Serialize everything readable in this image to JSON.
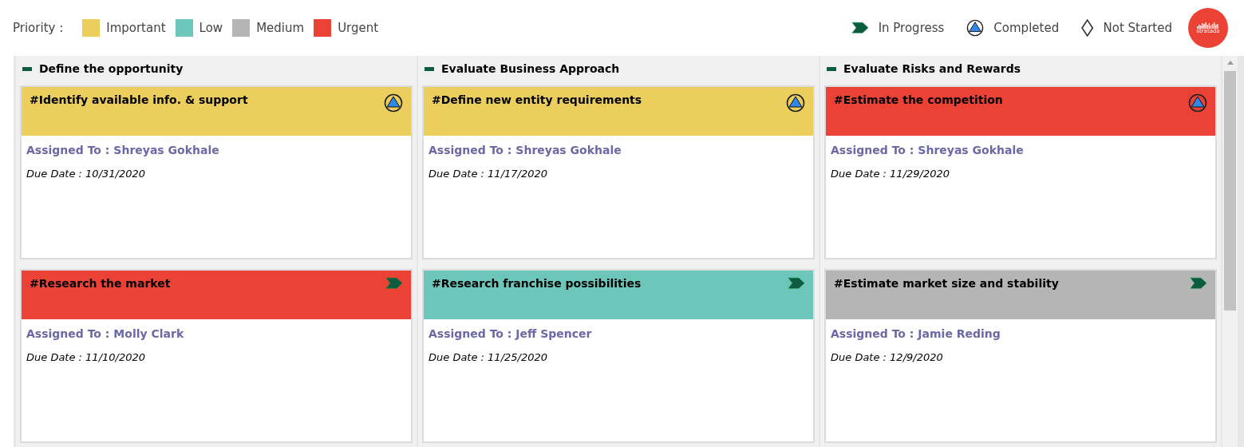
{
  "priority_legend": {
    "label": "Priority :",
    "items": [
      {
        "label": "Important",
        "color": "#ecce5c"
      },
      {
        "label": "Low",
        "color": "#6cc6b9"
      },
      {
        "label": "Medium",
        "color": "#b5b5b5"
      },
      {
        "label": "Urgent",
        "color": "#ec4236"
      }
    ]
  },
  "status_legend": [
    {
      "kind": "in_progress",
      "label": "In Progress"
    },
    {
      "kind": "completed",
      "label": "Completed"
    },
    {
      "kind": "not_started",
      "label": "Not Started"
    }
  ],
  "logo": {
    "text": "stratada"
  },
  "columns": [
    {
      "title": "Define the opportunity",
      "expanded": true,
      "cards": [
        {
          "title": "#Identify available info. & support",
          "color": "#ecce5c",
          "kind": "completed",
          "assigned": "Assigned To : Shreyas Gokhale",
          "due": "Due Date : 10/31/2020"
        },
        {
          "title": "#Research the market",
          "color": "#ec4236",
          "kind": "in_progress",
          "assigned": "Assigned To : Molly Clark",
          "due": "Due Date : 11/10/2020"
        }
      ]
    },
    {
      "title": "Evaluate Business Approach",
      "expanded": true,
      "cards": [
        {
          "title": "#Define new entity requirements",
          "color": "#ecce5c",
          "kind": "completed",
          "assigned": "Assigned To : Shreyas Gokhale",
          "due": "Due Date : 11/17/2020"
        },
        {
          "title": "#Research franchise possibilities",
          "color": "#6cc6b9",
          "kind": "in_progress",
          "assigned": "Assigned To : Jeff Spencer",
          "due": "Due Date : 11/25/2020"
        }
      ]
    },
    {
      "title": "Evaluate Risks and Rewards",
      "expanded": true,
      "cards": [
        {
          "title": "#Estimate the competition",
          "color": "#ec4236",
          "kind": "completed",
          "assigned": "Assigned To : Shreyas Gokhale",
          "due": "Due Date : 11/29/2020"
        },
        {
          "title": "#Estimate market size and stability",
          "color": "#b5b5b5",
          "kind": "in_progress",
          "assigned": "Assigned To : Jamie Reding",
          "due": "Due Date : 12/9/2020"
        }
      ]
    }
  ]
}
